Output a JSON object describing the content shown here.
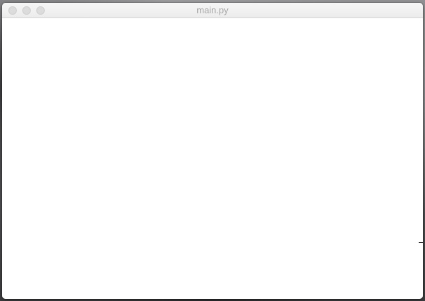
{
  "window": {
    "title": "main.py",
    "controls": {
      "close_icon": "close-icon",
      "minimize_icon": "minimize-icon",
      "zoom_icon": "zoom-icon",
      "inactive_color": "#dcdcdc"
    }
  },
  "colors": {
    "content_background": "#ffffff",
    "title_text": "#a8a8a8"
  }
}
